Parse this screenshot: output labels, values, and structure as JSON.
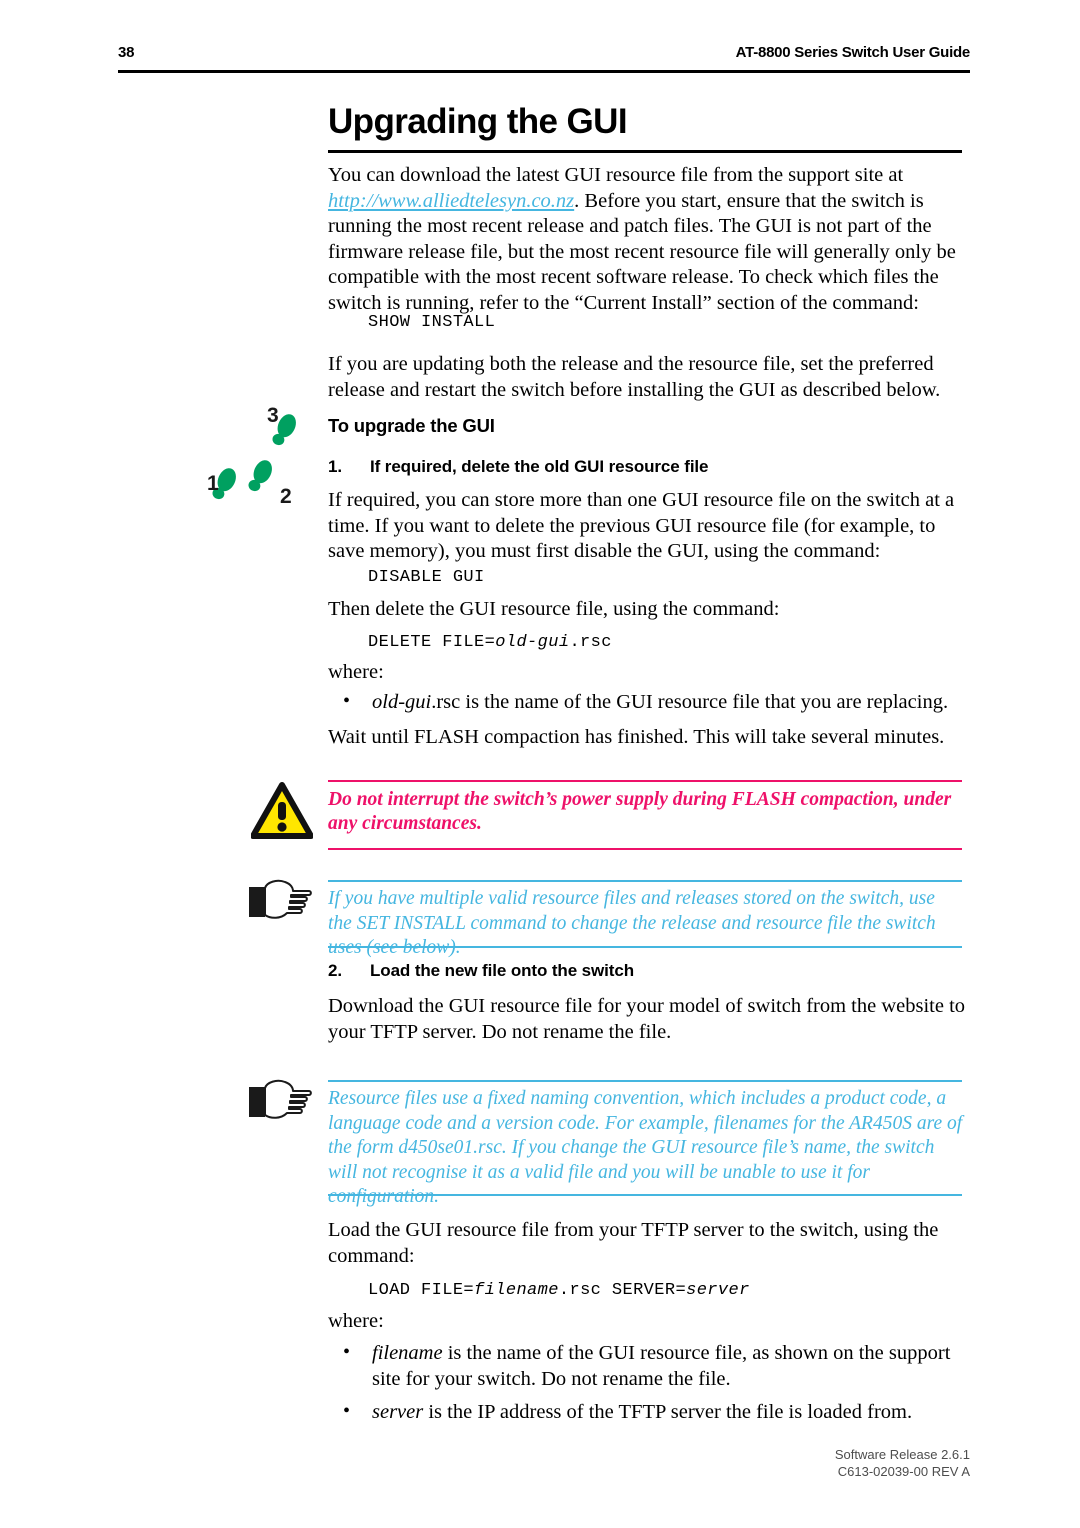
{
  "header": {
    "page_number": "38",
    "guide_title": "AT-8800 Series Switch User Guide"
  },
  "title": "Upgrading the GUI",
  "intro": {
    "part1": "You can download the latest GUI resource file from the support site at ",
    "link": "http://www.alliedtelesyn.co.nz",
    "part2": ". Before you start, ensure that the switch is running the most recent release and patch files. The GUI is not part of the firmware release file, but the most recent resource file will generally only be compatible with the most recent software release. To check which files the switch is running, refer to the “Current Install” section of the command:",
    "command": "SHOW INSTALL",
    "para2": "If you are updating both the release and the resource file, set the preferred release and restart the switch before installing the GUI as described below."
  },
  "procedure": {
    "heading": "To upgrade the GUI",
    "footprint_labels": {
      "one": "1",
      "two": "2",
      "three": "3"
    },
    "step1": {
      "number": "1.",
      "heading": "If required, delete the old GUI resource file",
      "para1": "If required, you can store more than one GUI resource file on the switch at a time. If you want to delete the previous GUI resource file (for example, to save memory), you must first disable the GUI, using the command:",
      "command1": "DISABLE GUI",
      "para2": "Then delete the GUI resource file, using the command:",
      "command2_prefix": "DELETE FILE=",
      "command2_var": "old-gui",
      "command2_suffix": ".rsc",
      "where_label": "where:",
      "bullet_var": "old-gui",
      "bullet_rest": ".rsc is the name of the GUI resource file that you are replacing.",
      "para3": "Wait until FLASH compaction has finished. This will take several minutes."
    },
    "step2": {
      "number": "2.",
      "heading": "Load the new file onto the switch",
      "para1": "Download the GUI resource file for your model of switch from the website to your TFTP server. Do not rename the file.",
      "para2": "Load the GUI resource file from your TFTP server to the switch, using the command:",
      "command_prefix": "LOAD FILE=",
      "command_var1": "filename",
      "command_mid": ".rsc SERVER=",
      "command_var2": "server",
      "where_label": "where:",
      "bullet1_var": "filename",
      "bullet1_rest": " is the name of the GUI resource file, as shown on the support site for your switch. Do not rename the file.",
      "bullet2_var": "server",
      "bullet2_rest": " is the IP address of the TFTP server the file is loaded from."
    }
  },
  "caution": {
    "icon": "warning-triangle-icon",
    "text": "Do not interrupt the switch’s power supply during FLASH compaction, under any circumstances.",
    "color": "#EE1169"
  },
  "note1": {
    "icon": "pointing-hand-icon",
    "text": "If you have multiple valid resource files and releases stored on the switch, use the SET INSTALL command to change the release and resource file the switch uses (see below).",
    "color": "#45B6E0"
  },
  "note2": {
    "icon": "pointing-hand-icon",
    "text": "Resource files use a fixed naming convention, which includes a product code, a language code and a version code. For example, filenames for the AR450S are of the form d450se01.rsc. If you change the GUI resource file’s name, the switch will not recognise it as a valid file and you will be unable to use it for configuration.",
    "color": "#45B6E0"
  },
  "footer": {
    "line1": "Software Release 2.6.1",
    "line2": "C613-02039-00 REV A"
  }
}
